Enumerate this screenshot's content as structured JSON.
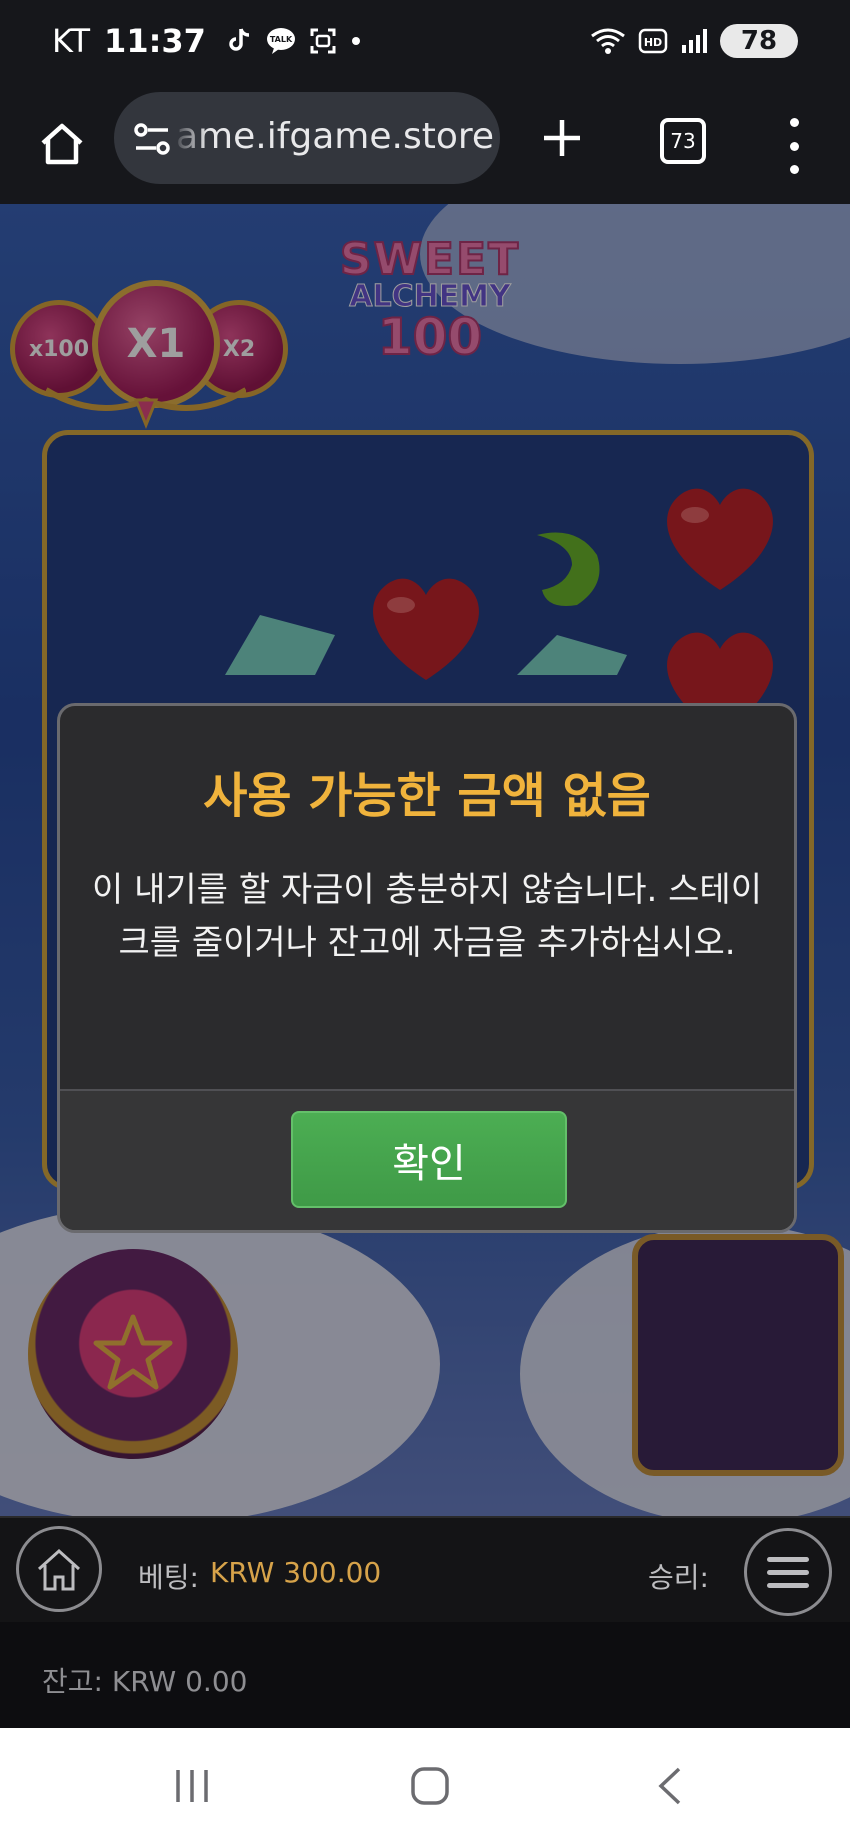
{
  "status_bar": {
    "carrier": "KT",
    "time": "11:37",
    "battery": "78",
    "icons": [
      "tiktok-icon",
      "talk-icon",
      "screenshot-icon",
      "dot-icon",
      "wifi-icon",
      "hd-icon",
      "signal-icon",
      "battery-icon"
    ],
    "talk_badge": "TALK",
    "hd_badge": "HD"
  },
  "browser": {
    "url": "ame.ifgame.store",
    "tab_count": "73",
    "icons": [
      "home-icon",
      "site-settings-icon",
      "plus-icon",
      "tabs-icon",
      "more-vert-icon"
    ]
  },
  "game": {
    "logo": {
      "line1": "SWEET",
      "line2": "ALCHEMY",
      "line3": "100"
    },
    "multipliers": {
      "left": "x100",
      "center": "X1",
      "right": "X2"
    },
    "colors": {
      "accent_gold": "#f0b33c",
      "confirm_green": "#4cae53",
      "frame_gold": "#d6a842"
    }
  },
  "dialog": {
    "title": "사용 가능한 금액 없음",
    "message": "이 내기를 할 자금이 충분하지 않습니다. 스테이크를 줄이거나 잔고에 자금을 추가하십시오.",
    "confirm_label": "확인"
  },
  "control_bar": {
    "bet_label": "베팅:",
    "bet_value": "KRW 300.00",
    "win_label": "승리:",
    "balance_label": "잔고: KRW 0.00"
  },
  "nav": {
    "icons": [
      "recent-apps-icon",
      "home-nav-icon",
      "back-icon"
    ]
  }
}
